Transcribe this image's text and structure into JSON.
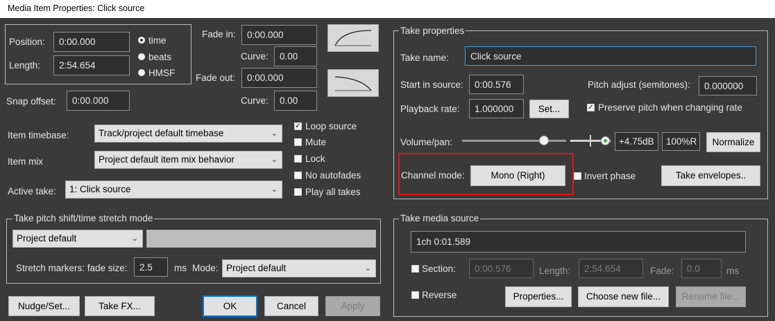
{
  "window": {
    "title": "Media Item Properties:  Click source"
  },
  "item": {
    "position_label": "Position:",
    "position_value": "0:00.000",
    "length_label": "Length:",
    "length_value": "2:54.654",
    "format_options": [
      "time",
      "beats",
      "HMSF"
    ],
    "format_selected": "time",
    "snap_offset_label": "Snap offset:",
    "snap_offset_value": "0:00.000",
    "fade_in_label": "Fade in:",
    "fade_in_value": "0:00.000",
    "curve_label": "Curve:",
    "fade_in_curve": "0.00",
    "fade_out_label": "Fade out:",
    "fade_out_value": "0:00.000",
    "fade_out_curve": "0.00",
    "timebase_label": "Item timebase:",
    "timebase_value": "Track/project default timebase",
    "mix_label": "Item mix",
    "mix_value": "Project default item mix behavior",
    "active_take_label": "Active take:",
    "active_take_value": "1: Click source"
  },
  "options": [
    {
      "label": "Loop source",
      "checked": true
    },
    {
      "label": "Mute",
      "checked": false
    },
    {
      "label": "Lock",
      "checked": false
    },
    {
      "label": "No autofades",
      "checked": false
    },
    {
      "label": "Play all takes",
      "checked": false
    }
  ],
  "take": {
    "group_title": "Take properties",
    "name_label": "Take name:",
    "name_value": "Click source",
    "start_label": "Start in source:",
    "start_value": "0:00.576",
    "pitch_label": "Pitch adjust (semitones):",
    "pitch_value": "0.000000",
    "rate_label": "Playback rate:",
    "rate_value": "1.000000",
    "set_button": "Set...",
    "preserve_label": "Preserve pitch when changing rate",
    "preserve_checked": true,
    "volpan_label": "Volume/pan:",
    "volume_value": "+4.75dB",
    "pan_value": "100%R",
    "normalize_button": "Normalize",
    "channel_label": "Channel mode:",
    "channel_value": "Mono (Right)",
    "invert_label": "Invert phase",
    "invert_checked": false,
    "envelopes_button": "Take envelopes.."
  },
  "pitch_shift": {
    "group_title": "Take pitch shift/time stretch mode",
    "mode_value": "Project default",
    "stretch_label": "Stretch markers: fade size:",
    "stretch_value": "2.5",
    "ms_label": "ms",
    "mode_label": "Mode:",
    "mode2_value": "Project default"
  },
  "media": {
    "group_title": "Take media source",
    "source_value": "1ch 0:01.589",
    "section_label": "Section:",
    "section_value": "0:00.576",
    "length_label": "Length:",
    "length_value": "2:54.654",
    "fade_label": "Fade:",
    "fade_value": "0.0",
    "ms_label": "ms",
    "reverse_label": "Reverse",
    "properties_button": "Properties...",
    "choose_button": "Choose new file...",
    "rename_button": "Rename file..."
  },
  "buttons": {
    "nudge": "Nudge/Set...",
    "take_fx": "Take FX...",
    "ok": "OK",
    "cancel": "Cancel",
    "apply": "Apply"
  },
  "colors": {
    "highlight": "#e0141e",
    "accent": "#0078d7",
    "background": "#3a3a3a"
  }
}
